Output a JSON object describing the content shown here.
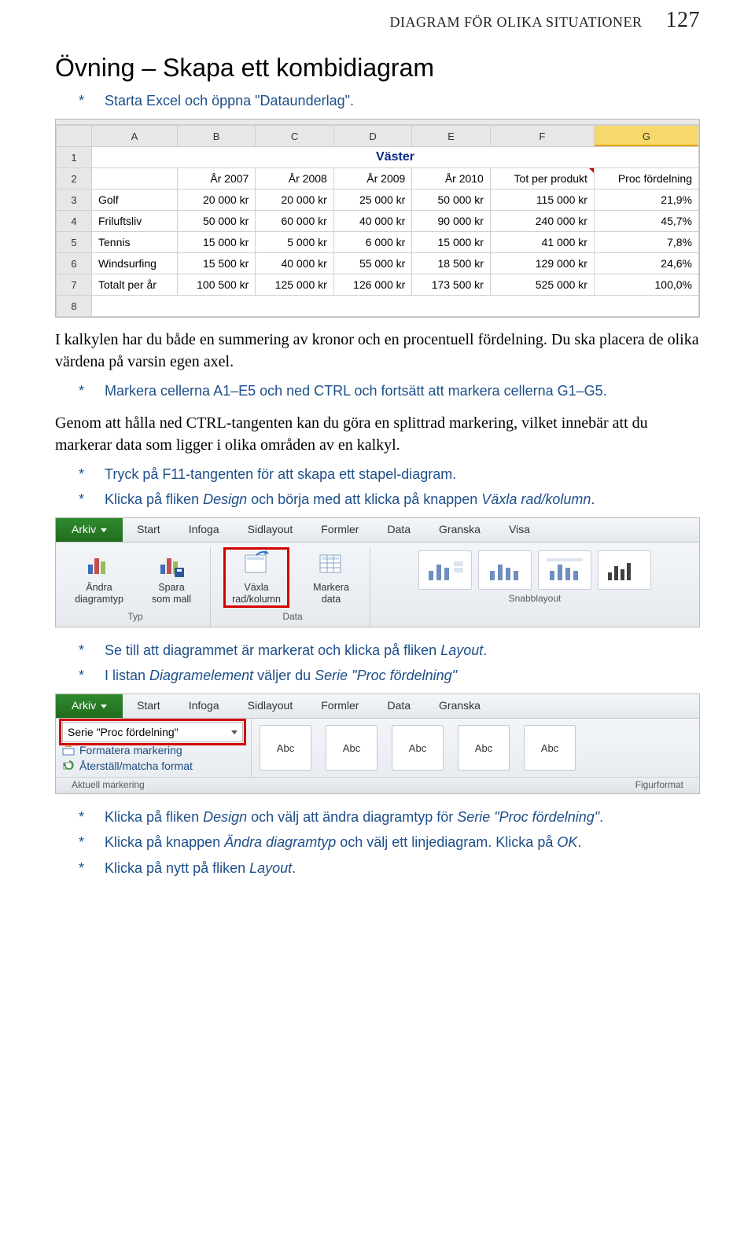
{
  "header": {
    "running_title": "DIAGRAM FÖR OLIKA SITUATIONER",
    "page_number": "127"
  },
  "h1": "Övning – Skapa ett kombidiagram",
  "steps": {
    "s1": "Starta Excel och öppna \"Dataunderlag\".",
    "p1": "I kalkylen har du både en summering av kronor och en procentuell fördelning. Du ska placera de olika värdena på varsin egen axel.",
    "s2": "Markera cellerna A1–E5 och ned CTRL och fortsätt att markera cellerna G1–G5.",
    "p2": "Genom att hålla ned CTRL-tangenten kan du göra en splittrad markering, vilket innebär att du markerar data som ligger i olika områden av en kalkyl.",
    "s3": "Tryck på F11-tangenten för att skapa ett stapel-diagram.",
    "s4_a": "Klicka på fliken ",
    "s4_b": "Design",
    "s4_c": " och börja med att klicka på knappen ",
    "s4_d": "Växla rad/kolumn",
    "s4_e": ".",
    "s5_a": "Se till att diagrammet är markerat och klicka på fliken ",
    "s5_b": "Layout",
    "s5_c": ".",
    "s6_a": "I listan ",
    "s6_b": "Diagramelement",
    "s6_c": " väljer du ",
    "s6_d": "Serie \"Proc fördelning\"",
    "s7_a": "Klicka på fliken ",
    "s7_b": "Design",
    "s7_c": " och välj att ändra diagramtyp för ",
    "s7_d": "Serie \"Proc fördelning\"",
    "s7_e": ".",
    "s8_a": "Klicka på knappen ",
    "s8_b": "Ändra diagramtyp",
    "s8_c": " och välj ett linjediagram. Klicka på ",
    "s8_d": "OK",
    "s8_e": ".",
    "s9_a": "Klicka på nytt på fliken ",
    "s9_b": "Layout",
    "s9_c": "."
  },
  "chart_data": {
    "type": "table",
    "title": "Väster",
    "columns": [
      "",
      "A",
      "B",
      "C",
      "D",
      "E",
      "F",
      "G"
    ],
    "header_row": [
      "",
      "År 2007",
      "År 2008",
      "År 2009",
      "År 2010",
      "Tot per produkt",
      "Proc fördelning"
    ],
    "rows": [
      {
        "n": "3",
        "label": "Golf",
        "v": [
          "20 000 kr",
          "20 000 kr",
          "25 000 kr",
          "50 000 kr",
          "115 000 kr",
          "21,9%"
        ]
      },
      {
        "n": "4",
        "label": "Friluftsliv",
        "v": [
          "50 000 kr",
          "60 000 kr",
          "40 000 kr",
          "90 000 kr",
          "240 000 kr",
          "45,7%"
        ]
      },
      {
        "n": "5",
        "label": "Tennis",
        "v": [
          "15 000 kr",
          "5 000 kr",
          "6 000 kr",
          "15 000 kr",
          "41 000 kr",
          "7,8%"
        ]
      },
      {
        "n": "6",
        "label": "Windsurfing",
        "v": [
          "15 500 kr",
          "40 000 kr",
          "55 000 kr",
          "18 500 kr",
          "129 000 kr",
          "24,6%"
        ]
      },
      {
        "n": "7",
        "label": "Totalt per år",
        "v": [
          "100 500 kr",
          "125 000 kr",
          "126 000 kr",
          "173 500 kr",
          "525 000 kr",
          "100,0%"
        ]
      }
    ],
    "row_after": "8"
  },
  "ribbon1": {
    "tabs": [
      "Arkiv",
      "Start",
      "Infoga",
      "Sidlayout",
      "Formler",
      "Data",
      "Granska",
      "Visa"
    ],
    "group_typ": {
      "label": "Typ",
      "btn1_l1": "Ändra",
      "btn1_l2": "diagramtyp",
      "btn2_l1": "Spara",
      "btn2_l2": "som mall"
    },
    "group_data": {
      "label": "Data",
      "btn1_l1": "Växla",
      "btn1_l2": "rad/kolumn",
      "btn2_l1": "Markera",
      "btn2_l2": "data"
    },
    "group_layout": {
      "label": "Snabblayout"
    }
  },
  "ribbon2": {
    "tabs": [
      "Arkiv",
      "Start",
      "Infoga",
      "Sidlayout",
      "Formler",
      "Data",
      "Granska"
    ],
    "combo_value": "Serie \"Proc fördelning\"",
    "link1": "Formatera markering",
    "link2": "Återställ/matcha format",
    "left_label": "Aktuell markering",
    "abc": "Abc",
    "right_label": "Figurformat"
  }
}
